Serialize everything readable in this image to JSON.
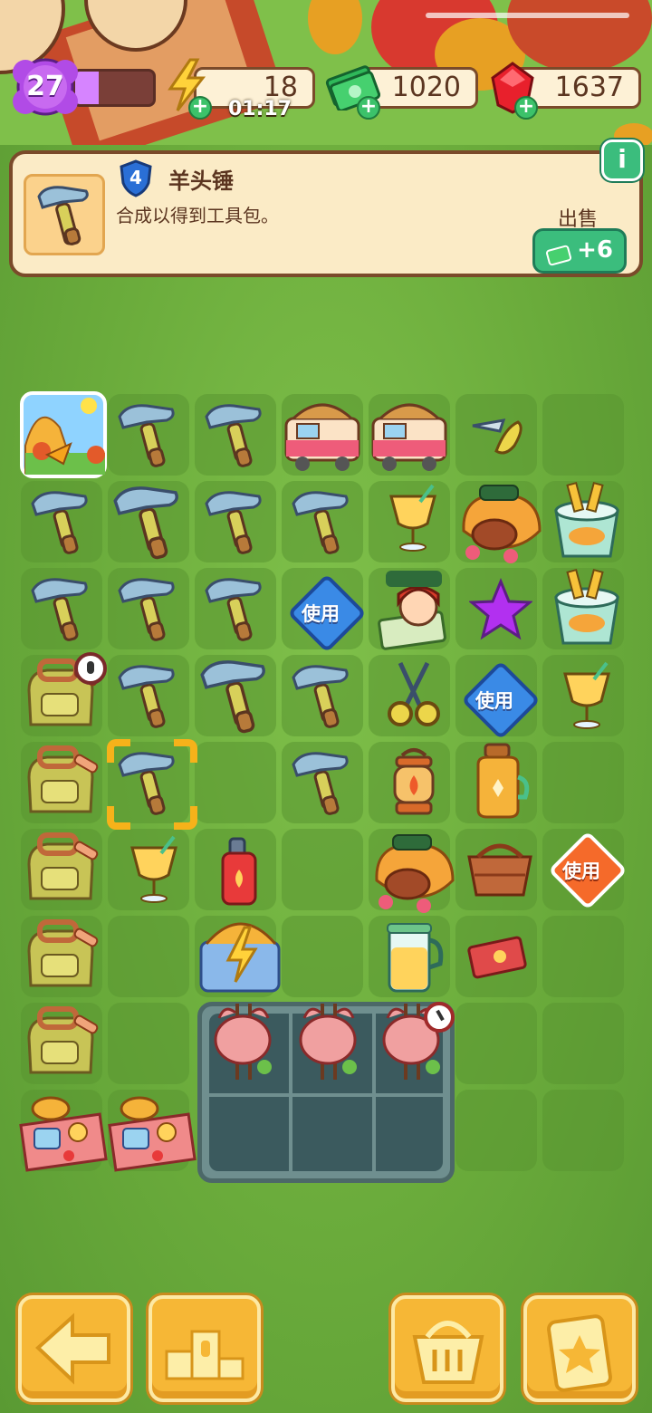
{
  "status": {
    "level": "27",
    "xp_fraction": 0.3
  },
  "resources": {
    "energy": {
      "value": "18",
      "timer": "01:17",
      "icon": "lightning-icon"
    },
    "cash": {
      "value": "1020",
      "icon": "cash-icon"
    },
    "gems": {
      "value": "1637",
      "icon": "ruby-icon"
    }
  },
  "selected_item": {
    "level": "4",
    "name": "羊头锤",
    "description": "合成以得到工具包。",
    "sell_label": "出售",
    "sell_value": "+6",
    "info_label": "i"
  },
  "use_label": "使用",
  "bottom_buttons": [
    {
      "name": "back-button",
      "icon": "arrow-left-icon"
    },
    {
      "name": "leaderboard-button",
      "icon": "podium-icon"
    },
    {
      "name": "basket-button",
      "icon": "basket-icon"
    },
    {
      "name": "tasks-button",
      "icon": "clipboard-star-icon"
    }
  ],
  "colors": {
    "accent_green": "#3bbd7d",
    "panel": "#fbebc6",
    "wood": "#7a4a2a",
    "button_orange": "#f6b736"
  }
}
